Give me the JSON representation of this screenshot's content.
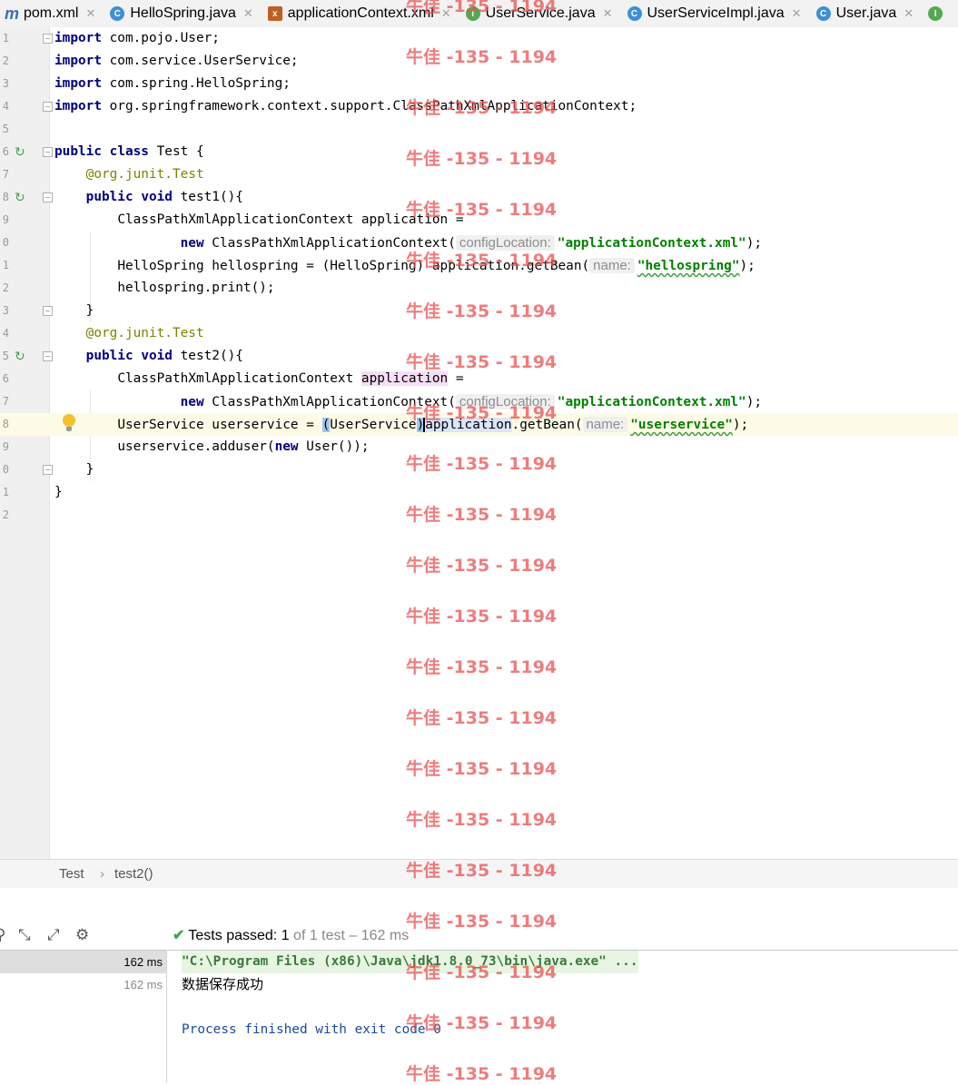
{
  "tabs": [
    {
      "label": "pom.xml",
      "icon": "m"
    },
    {
      "label": "HelloSpring.java",
      "icon": "c"
    },
    {
      "label": "applicationContext.xml",
      "icon": "x"
    },
    {
      "label": "UserService.java",
      "icon": "i"
    },
    {
      "label": "UserServiceImpl.java",
      "icon": "c"
    },
    {
      "label": "User.java",
      "icon": "c"
    },
    {
      "label": "",
      "icon": "i"
    }
  ],
  "editor": {
    "line_numbers": [
      "1",
      "2",
      "3",
      "4",
      "5",
      "6",
      "7",
      "8",
      "9",
      "0",
      "1",
      "2",
      "3",
      "4",
      "5",
      "6",
      "7",
      "8",
      "9",
      "0",
      "1",
      "2"
    ],
    "tokens": {
      "import": "import",
      "imp1": " com.pojo.User;",
      "imp2": " com.service.UserService;",
      "imp3": " com.spring.HelloSpring;",
      "imp4": " org.springframework.context.support.ClassPathXmlApplicationContext;",
      "public": "public",
      "class": "class",
      "test_class": " Test {",
      "ann_prefix": "@org.junit.",
      "ann_name": "Test",
      "void": "void",
      "test1_sig": " test1(){",
      "test2_sig": " test2(){",
      "cpx_decl": "ClassPathXmlApplicationContext application =",
      "cpx_decl_prefix": "ClassPathXmlApplicationContext ",
      "application": "application",
      "assign_eq": " =",
      "new": "new",
      "cpx_ctor": " ClassPathXmlApplicationContext(",
      "hint_config": "configLocation:",
      "str_config": "\"applicationContext.xml\"",
      "close_paren": ");",
      "hello_decl": "HelloSpring hellospring = (HelloSpring) application.getBean(",
      "hint_name": "name:",
      "str_hellospring": "\"hellospring\"",
      "hello_print": "hellospring.print();",
      "close_brace": "}",
      "us_decl": "UserService userservice = ",
      "open_paren": "(",
      "us_cast": "UserService",
      "cast_close": ")",
      "get_bean": ".getBean(",
      "str_userservice": "\"userservice\"",
      "adduser_pre": "userservice.adduser(",
      "user_ctor": " User());"
    }
  },
  "breadcrumb": {
    "class_name": "Test",
    "separator": "›",
    "method_name": "test2()"
  },
  "run": {
    "status_prefix": "Tests passed:",
    "passed_count": "1",
    "status_suffix": "of 1 test – 162 ms",
    "tree_times": [
      "162 ms",
      "162 ms"
    ],
    "console_lines": [
      "\"C:\\Program Files (x86)\\Java\\jdk1.8.0_73\\bin\\java.exe\" ...",
      "数据保存成功",
      "",
      "Process finished with exit code 0"
    ]
  },
  "watermark": "牛佳 -135 - 1194",
  "colors": {
    "keyword": "#000080",
    "string": "#008000",
    "annotation": "#808000",
    "run_icon": "#499c54",
    "watermark": "#e95050"
  }
}
